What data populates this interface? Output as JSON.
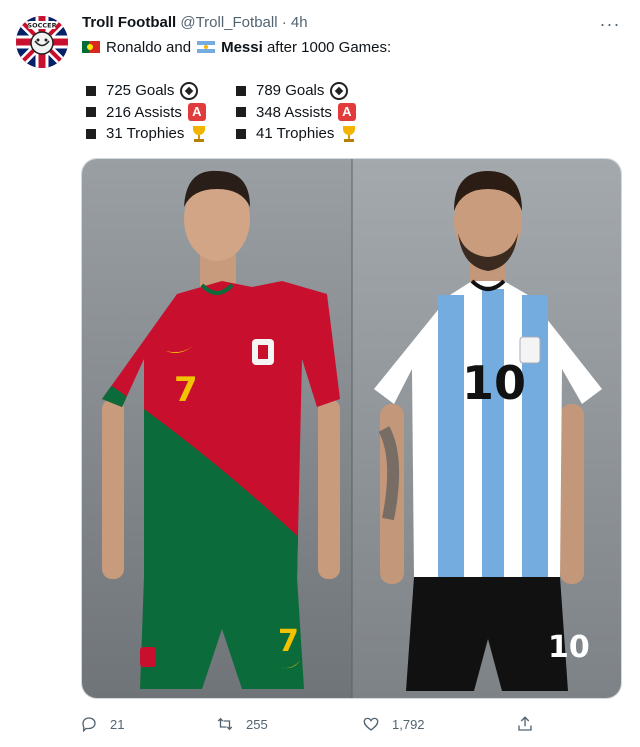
{
  "author": {
    "name": "Troll Football",
    "handle": "@Troll_Fotball",
    "dot": "·",
    "time": "4h",
    "avatar_label": "SOCCER"
  },
  "more_label": "···",
  "tweet_text": {
    "part1": "Ronaldo and",
    "name2": "Messi",
    "part2": "after 1000 Games:"
  },
  "stats": {
    "left": [
      {
        "label": "725 Goals",
        "emoji": "soccer-ball-icon"
      },
      {
        "label": "216 Assists",
        "emoji": "a-button-icon"
      },
      {
        "label": "31 Trophies",
        "emoji": "trophy-icon"
      }
    ],
    "right": [
      {
        "label": "789 Goals",
        "emoji": "soccer-ball-icon"
      },
      {
        "label": "348 Assists",
        "emoji": "a-button-icon"
      },
      {
        "label": "41 Trophies",
        "emoji": "trophy-icon"
      }
    ],
    "a_badge": "A"
  },
  "media": {
    "left_number": "7",
    "right_number": "10"
  },
  "actions": {
    "reply_count": "21",
    "retweet_count": "255",
    "like_count": "1,792"
  },
  "colors": {
    "text": "#0f1419",
    "secondary": "#536471",
    "portugal_red": "#c8102e",
    "portugal_green": "#0b6b3a",
    "argentina_blue": "#74acdf"
  }
}
